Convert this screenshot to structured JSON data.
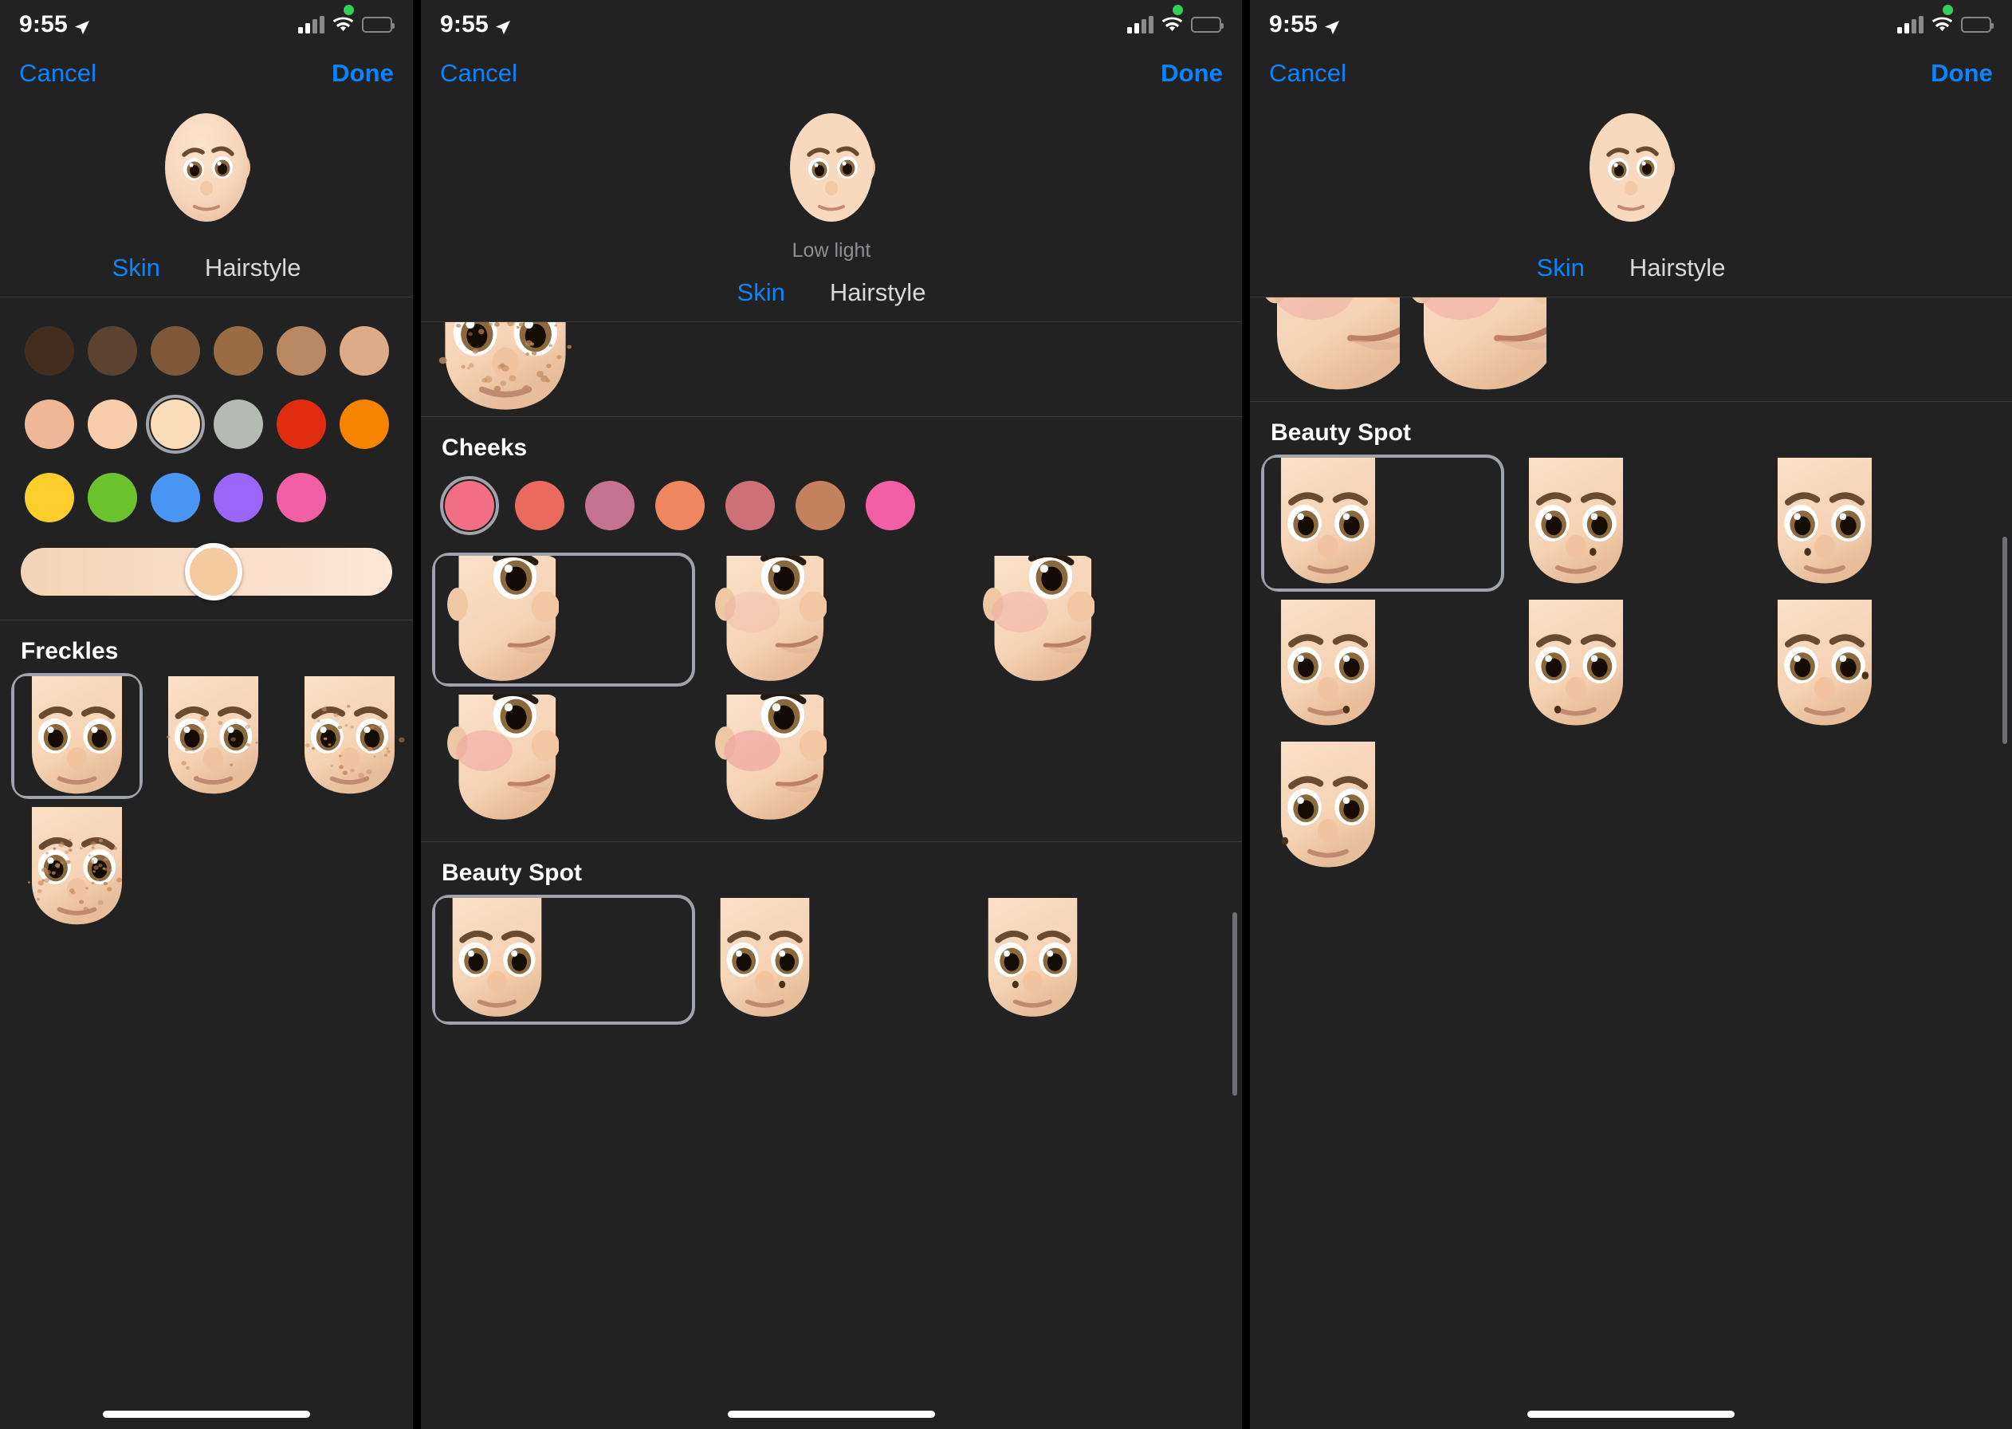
{
  "app": {
    "name": "Memoji Editor"
  },
  "status_bar": {
    "time": "9:55",
    "location_icon": "location-arrow-icon",
    "recording_indicator": "green-dot-indicator",
    "cellular_icon": "cellular-bars-icon",
    "wifi_icon": "wifi-icon",
    "battery_icon": "battery-icon",
    "battery_fill_color": "#FFD60A",
    "battery_level_percent": 45
  },
  "nav": {
    "cancel_label": "Cancel",
    "done_label": "Done",
    "accent_color": "#0A84FF"
  },
  "tabs": {
    "skin_label": "Skin",
    "hairstyle_label": "Hairstyle",
    "active": "Skin"
  },
  "screens": [
    {
      "id": "screen-1",
      "preview": {
        "avatar_name": "memoji-avatar-preview",
        "caption": ""
      },
      "sections": [
        {
          "title": "",
          "type": "color-grid",
          "selected_index": 8,
          "colors": [
            "#422d1f",
            "#5b4231",
            "#7e5838",
            "#9a6c44",
            "#b98963",
            "#ddac86",
            "#eeb795",
            "#f8cda9",
            "#fbdcbb",
            "#b6bab5",
            "#e02d10",
            "#f78400",
            "#fccf2e",
            "#6cc22c",
            "#4a96f5",
            "#9966f7",
            "#f25fa5"
          ],
          "slider": {
            "name": "skin-tone-slider",
            "value_percent": 52,
            "thumb_color": "#f4ca9f"
          }
        },
        {
          "title": "Freckles",
          "type": "face-grid",
          "columns": 3,
          "selected_index": 0,
          "options": [
            "none",
            "light",
            "medium",
            "heavy"
          ]
        }
      ]
    },
    {
      "id": "screen-2",
      "preview": {
        "avatar_name": "memoji-avatar-preview",
        "caption": "Low light"
      },
      "sections": [
        {
          "title": "",
          "type": "partial-face-row",
          "options": [
            "freckles-heavy"
          ]
        },
        {
          "title": "Cheeks",
          "type": "color-grid-row",
          "selected_index": 0,
          "colors": [
            "#f26f85",
            "#ea6a5d",
            "#c4728f",
            "#ef8660",
            "#cd7077",
            "#c4815e",
            "#f25fa5"
          ]
        },
        {
          "title": "",
          "type": "face-grid",
          "columns": 3,
          "selected_index": 0,
          "options": [
            "none",
            "soft",
            "light",
            "medium",
            "strong"
          ]
        },
        {
          "title": "Beauty Spot",
          "type": "face-grid",
          "columns": 3,
          "selected_index": 0,
          "options": [
            "none",
            "right-cheek",
            "left-cheek"
          ]
        }
      ]
    },
    {
      "id": "screen-3",
      "preview": {
        "avatar_name": "memoji-avatar-preview",
        "caption": ""
      },
      "sections": [
        {
          "title": "",
          "type": "partial-face-row",
          "options": [
            "cheek-1",
            "cheek-2"
          ]
        },
        {
          "title": "Beauty Spot",
          "type": "face-grid",
          "columns": 3,
          "selected_index": 0,
          "options": [
            "none",
            "right-nose",
            "left-nose",
            "right-chin",
            "left-chin",
            "right-eye",
            "left-jaw"
          ]
        }
      ]
    }
  ],
  "home_indicator": "home-indicator"
}
